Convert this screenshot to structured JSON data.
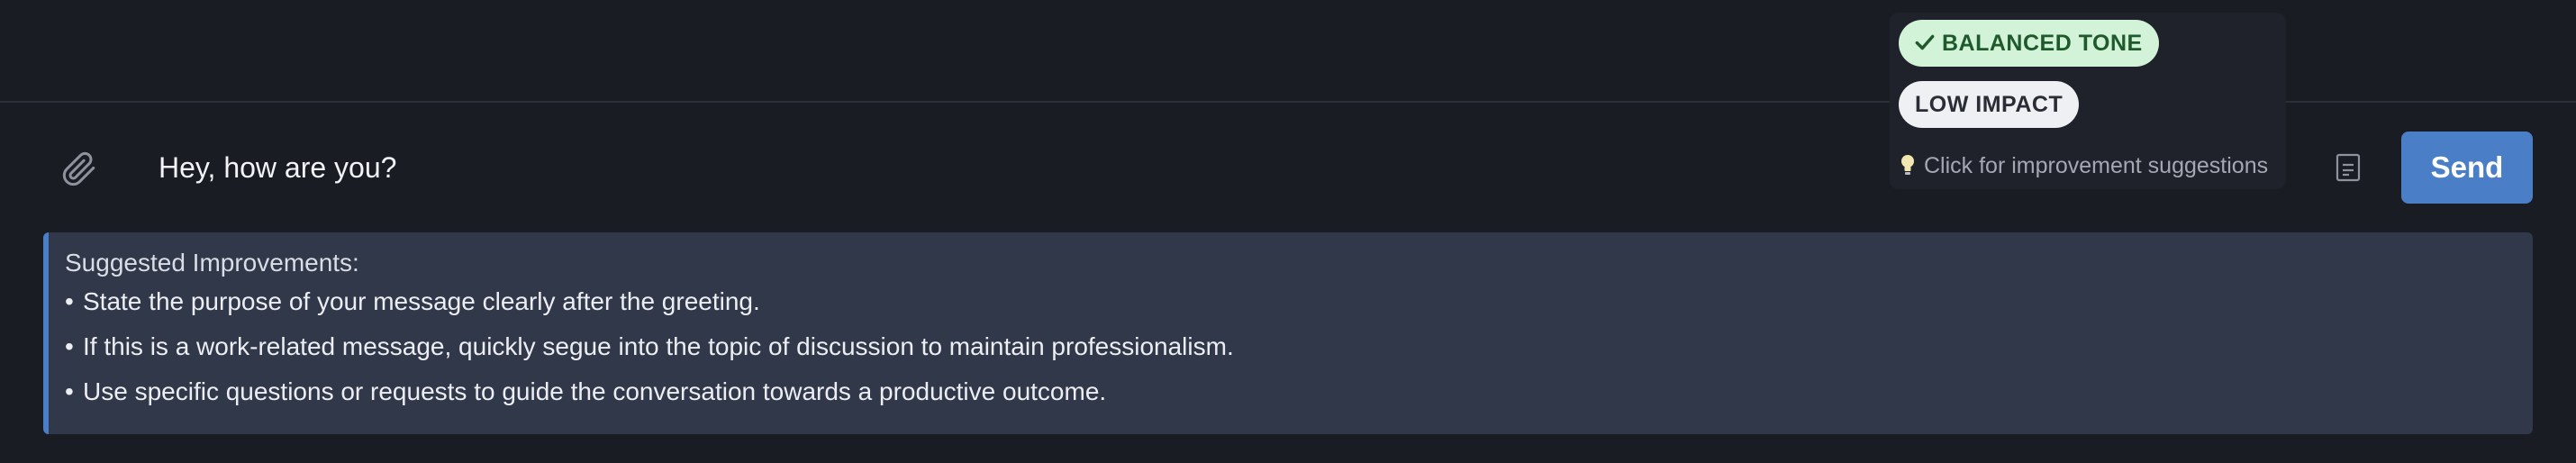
{
  "composer": {
    "message": "Hey, how are you?",
    "send_label": "Send"
  },
  "tone_panel": {
    "tone_badge": "BALANCED TONE",
    "impact_badge": "LOW IMPACT",
    "hint": "Click for improvement suggestions"
  },
  "suggestions": {
    "title": "Suggested Improvements:",
    "items": [
      "State the purpose of your message clearly after the greeting.",
      "If this is a work-related message, quickly segue into the topic of discussion to maintain professionalism.",
      "Use specific questions or requests to guide the conversation towards a productive outcome."
    ]
  },
  "icons": {
    "attach": "paperclip-icon",
    "check": "check-icon",
    "hint": "lightbulb-icon",
    "document": "document-icon"
  },
  "colors": {
    "background": "#1a1c24",
    "accent": "#4a7fc8",
    "tone_badge_bg": "#d2f3d7",
    "tone_badge_text": "#1f5a2c",
    "suggestions_bg": "#313849"
  }
}
